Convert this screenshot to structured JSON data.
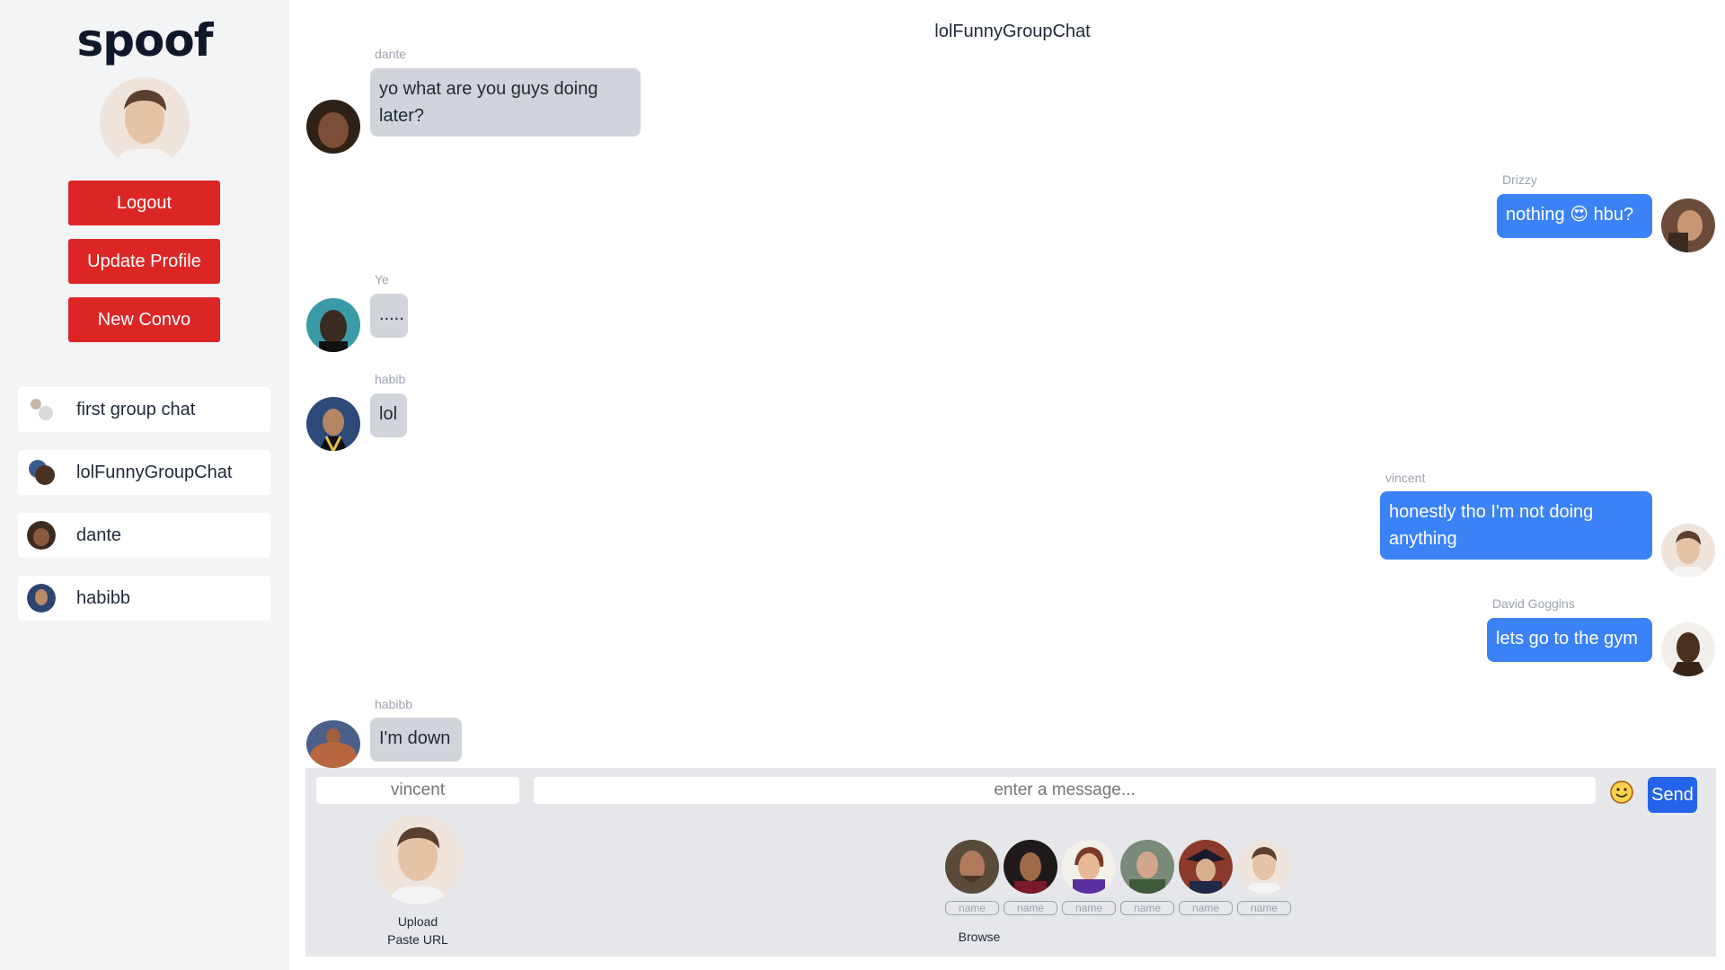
{
  "app": {
    "logo": "spoof"
  },
  "sidebar": {
    "buttons": {
      "logout": "Logout",
      "update_profile": "Update Profile",
      "new_convo": "New Convo"
    },
    "conversations": [
      {
        "label": "first group chat"
      },
      {
        "label": "lolFunnyGroupChat"
      },
      {
        "label": "dante"
      },
      {
        "label": "habibb"
      }
    ]
  },
  "chat": {
    "title": "lolFunnyGroupChat",
    "messages": [
      {
        "sender": "dante",
        "line1": "yo what are you guys doing",
        "line2": "later?"
      },
      {
        "sender": "Drizzy",
        "text": "nothing",
        "emoji": "😍",
        "text2": "hbu?"
      },
      {
        "sender": "Ye",
        "text": "....."
      },
      {
        "sender": "habib",
        "text": "lol"
      },
      {
        "sender": "vincent",
        "line1": "honestly tho I'm not doing",
        "line2": "anything"
      },
      {
        "sender": "David Goggins",
        "text": "lets go to the gym"
      },
      {
        "sender": "habibb",
        "text": "I'm down"
      }
    ]
  },
  "composer": {
    "name_placeholder": "vincent",
    "message_placeholder": "enter a message...",
    "send_label": "Send",
    "upload_label": "Upload",
    "paste_label": "Paste URL",
    "browse_label": "Browse",
    "browse_tag": "name"
  },
  "colors": {
    "accent_red": "#dc2626",
    "accent_blue": "#3b82f6",
    "bubble_gray": "#d1d5db"
  }
}
